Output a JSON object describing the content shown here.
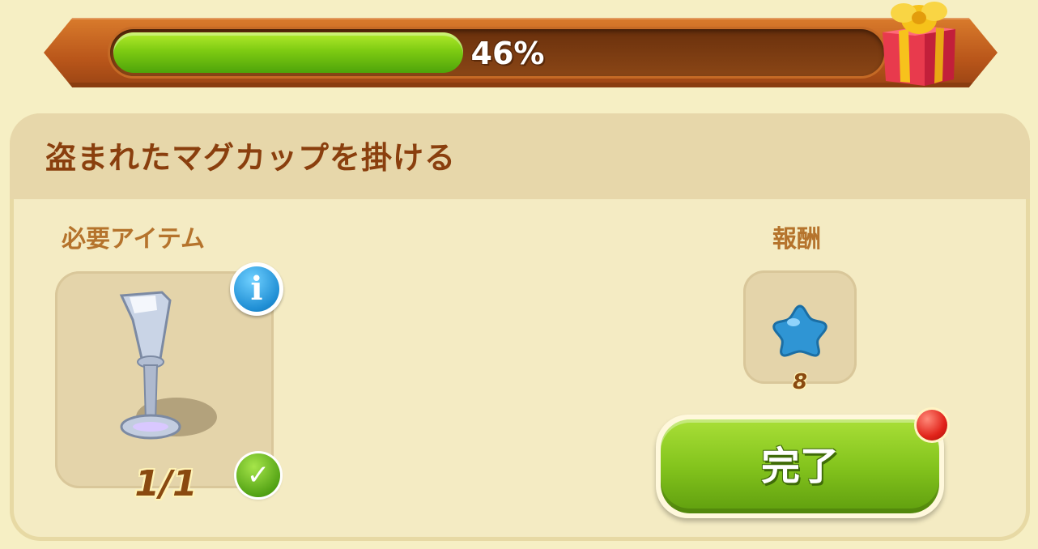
{
  "progress": {
    "label": "46%",
    "value": 0.46
  },
  "task": {
    "title": "盗まれたマグカップを掛ける"
  },
  "required": {
    "label": "必要アイテム",
    "item_icon": "silver-goblet-icon",
    "count": "1/1",
    "info_icon": "info-icon",
    "status_icon": "checkmark-icon"
  },
  "reward": {
    "label": "報酬",
    "icon": "blue-star-icon",
    "amount": "8"
  },
  "actions": {
    "complete_label": "完了",
    "has_notification": true
  },
  "colors": {
    "background": "#f6efc4",
    "bar_frame": "#c2621f",
    "bar_fill": "#7ecb12",
    "title_text": "#8a3f0e",
    "label_text": "#b5732c",
    "button_green": "#84c41d",
    "notify_red": "#e1231a"
  }
}
